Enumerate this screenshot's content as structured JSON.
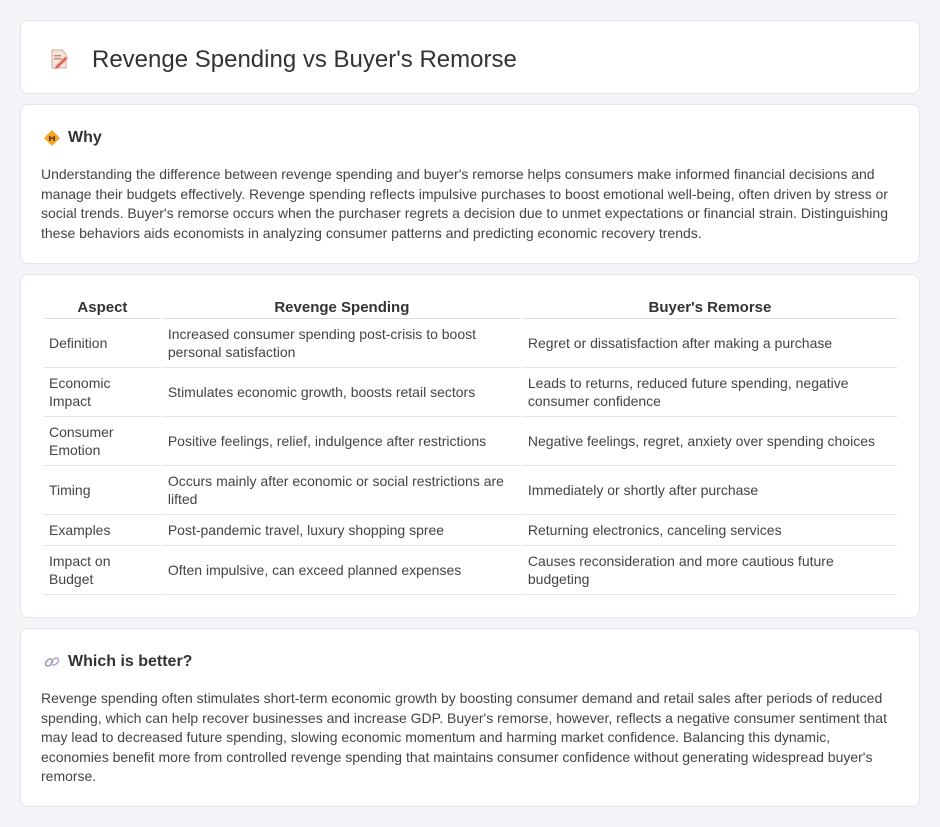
{
  "header": {
    "title": "Revenge Spending vs Buyer's Remorse",
    "icon": "document-edit-icon"
  },
  "why": {
    "heading": "Why",
    "icon": "diamond-sign-icon",
    "text": "Understanding the difference between revenge spending and buyer's remorse helps consumers make informed financial decisions and manage their budgets effectively. Revenge spending reflects impulsive purchases to boost emotional well-being, often driven by stress or social trends. Buyer's remorse occurs when the purchaser regrets a decision due to unmet expectations or financial strain. Distinguishing these behaviors aids economists in analyzing consumer patterns and predicting economic recovery trends."
  },
  "table": {
    "headers": [
      "Aspect",
      "Revenge Spending",
      "Buyer's Remorse"
    ],
    "rows": [
      [
        "Definition",
        "Increased consumer spending post-crisis to boost personal satisfaction",
        "Regret or dissatisfaction after making a purchase"
      ],
      [
        "Economic Impact",
        "Stimulates economic growth, boosts retail sectors",
        "Leads to returns, reduced future spending, negative consumer confidence"
      ],
      [
        "Consumer Emotion",
        "Positive feelings, relief, indulgence after restrictions",
        "Negative feelings, regret, anxiety over spending choices"
      ],
      [
        "Timing",
        "Occurs mainly after economic or social restrictions are lifted",
        "Immediately or shortly after purchase"
      ],
      [
        "Examples",
        "Post-pandemic travel, luxury shopping spree",
        "Returning electronics, canceling services"
      ],
      [
        "Impact on Budget",
        "Often impulsive, can exceed planned expenses",
        "Causes reconsideration and more cautious future budgeting"
      ]
    ]
  },
  "better": {
    "heading": "Which is better?",
    "icon": "link-icon",
    "text": "Revenge spending often stimulates short-term economic growth by boosting consumer demand and retail sales after periods of reduced spending, which can help recover businesses and increase GDP. Buyer's remorse, however, reflects a negative consumer sentiment that may lead to decreased future spending, slowing economic momentum and harming market confidence. Balancing this dynamic, economies benefit more from controlled revenge spending that maintains consumer confidence without generating widespread buyer's remorse."
  }
}
